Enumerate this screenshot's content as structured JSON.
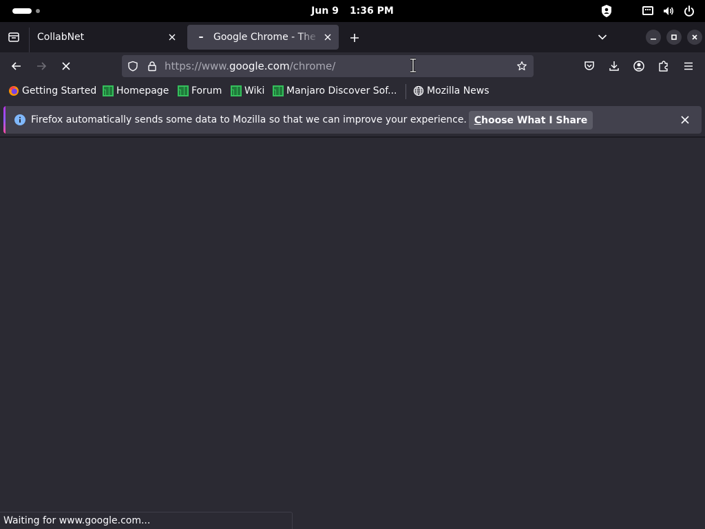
{
  "system_bar": {
    "date": "Jun 9",
    "time": "1:36 PM"
  },
  "tabs": [
    {
      "title": "CollabNet",
      "active": false
    },
    {
      "title": "Google Chrome - The Fast & Secure Web Browser",
      "active": true,
      "loading": true
    }
  ],
  "address_bar": {
    "url_prefix": "https://www.",
    "url_host": "google.com",
    "url_path": "/chrome/"
  },
  "bookmarks": [
    {
      "label": "Getting Started",
      "icon": "firefox-icon"
    },
    {
      "label": "Homepage",
      "icon": "manjaro-icon"
    },
    {
      "label": "Forum",
      "icon": "manjaro-icon"
    },
    {
      "label": "Wiki",
      "icon": "manjaro-icon"
    },
    {
      "label": "Manjaro Discover Sof...",
      "icon": "manjaro-icon"
    },
    {
      "label": "Mozilla News",
      "icon": "globe-icon"
    }
  ],
  "notification": {
    "message": "Firefox automatically sends some data to Mozilla so that we can improve your experience.",
    "button_accesskey": "C",
    "button_rest": "hoose What I Share"
  },
  "status": {
    "text": "Waiting for www.google.com..."
  },
  "colors": {
    "toolbar": "#2b2a33",
    "tabstrip": "#1c1b22",
    "field": "#42414d",
    "manjaro_green": "#35bf5c",
    "info_blue": "#80b8fc"
  }
}
